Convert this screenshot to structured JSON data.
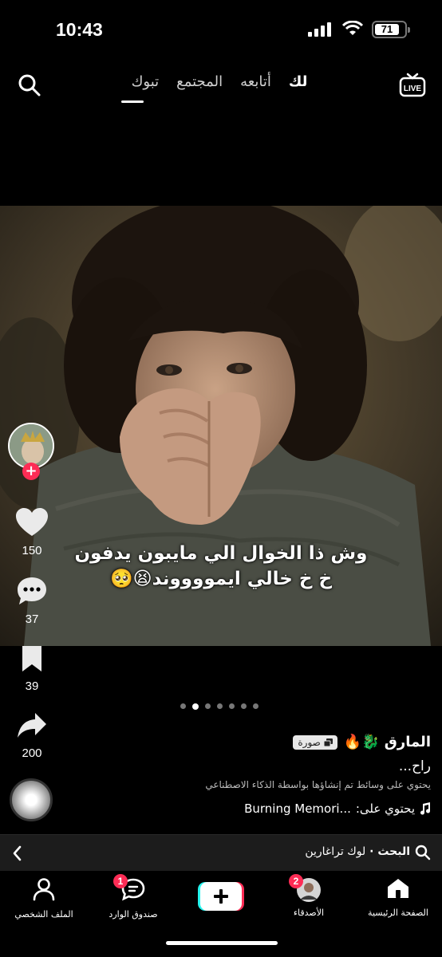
{
  "status_bar": {
    "time": "10:43",
    "battery": "71"
  },
  "top_nav": {
    "tabs": [
      {
        "label": "لك",
        "active": true
      },
      {
        "label": "أتابعه",
        "active": false
      },
      {
        "label": "المجتمع",
        "active": false
      },
      {
        "label": "تبوك",
        "active": false
      }
    ],
    "live_label": "LIVE"
  },
  "post": {
    "caption_line1": "وش ذا الخوال الي مايبون يدفون",
    "caption_line2": "خ خ خالي ايمووووند😫🥺",
    "likes": "150",
    "comments": "37",
    "saves": "39",
    "shares": "200",
    "carousel_total": 7,
    "carousel_active": 1,
    "author": "المارق 🐉🔥",
    "type_badge": "صورة",
    "description": "راح...",
    "ai_note": "يحتوي على وسائط تم إنشاؤها بواسطة الذكاء الاصطناعي",
    "music_prefix": "يحتوي على:",
    "music_title": "Burning Memori..."
  },
  "search_suggestion": {
    "prefix": "البحث · ",
    "query": "لوك تراغارين"
  },
  "tabbar": {
    "home": "الصفحة الرئيسية",
    "friends": "الأصدقاء",
    "friends_badge": "2",
    "inbox": "صندوق الوارد",
    "inbox_badge": "1",
    "profile": "الملف الشخصي"
  },
  "colors": {
    "accent": "#fe2c55",
    "cyan": "#25f4ee",
    "background": "#000000"
  }
}
